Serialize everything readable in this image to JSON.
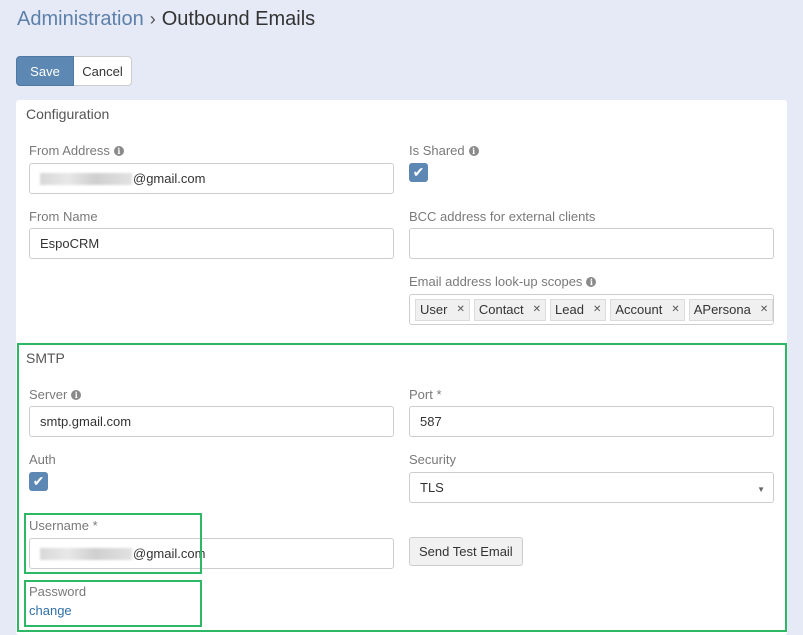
{
  "breadcrumb": {
    "parent": "Administration",
    "separator": "›",
    "current": "Outbound Emails"
  },
  "toolbar": {
    "save_label": "Save",
    "cancel_label": "Cancel"
  },
  "configuration": {
    "title": "Configuration",
    "from_address": {
      "label": "From Address",
      "value_suffix": "@gmail.com"
    },
    "is_shared": {
      "label": "Is Shared",
      "checked": true
    },
    "from_name": {
      "label": "From Name",
      "value": "EspoCRM"
    },
    "bcc": {
      "label": "BCC address for external clients",
      "value": ""
    },
    "lookup_scopes": {
      "label": "Email address look-up scopes",
      "tags": [
        "User",
        "Contact",
        "Lead",
        "Account",
        "APersona"
      ]
    }
  },
  "smtp": {
    "title": "SMTP",
    "server": {
      "label": "Server",
      "value": "smtp.gmail.com"
    },
    "port": {
      "label": "Port *",
      "value": "587"
    },
    "auth": {
      "label": "Auth",
      "checked": true
    },
    "security": {
      "label": "Security",
      "value": "TLS"
    },
    "username": {
      "label": "Username *",
      "value_suffix": "@gmail.com"
    },
    "send_test": {
      "label": "Send Test Email"
    },
    "password": {
      "label": "Password",
      "link": "change"
    }
  },
  "icons": {
    "info": "info-icon",
    "check": "checkmark-icon",
    "remove": "close-icon",
    "caret": "caret-down-icon"
  },
  "colors": {
    "primary": "#5d88b3",
    "link": "#2f6fa7",
    "highlight": "#2db866",
    "page_bg": "#e6eaf7"
  }
}
